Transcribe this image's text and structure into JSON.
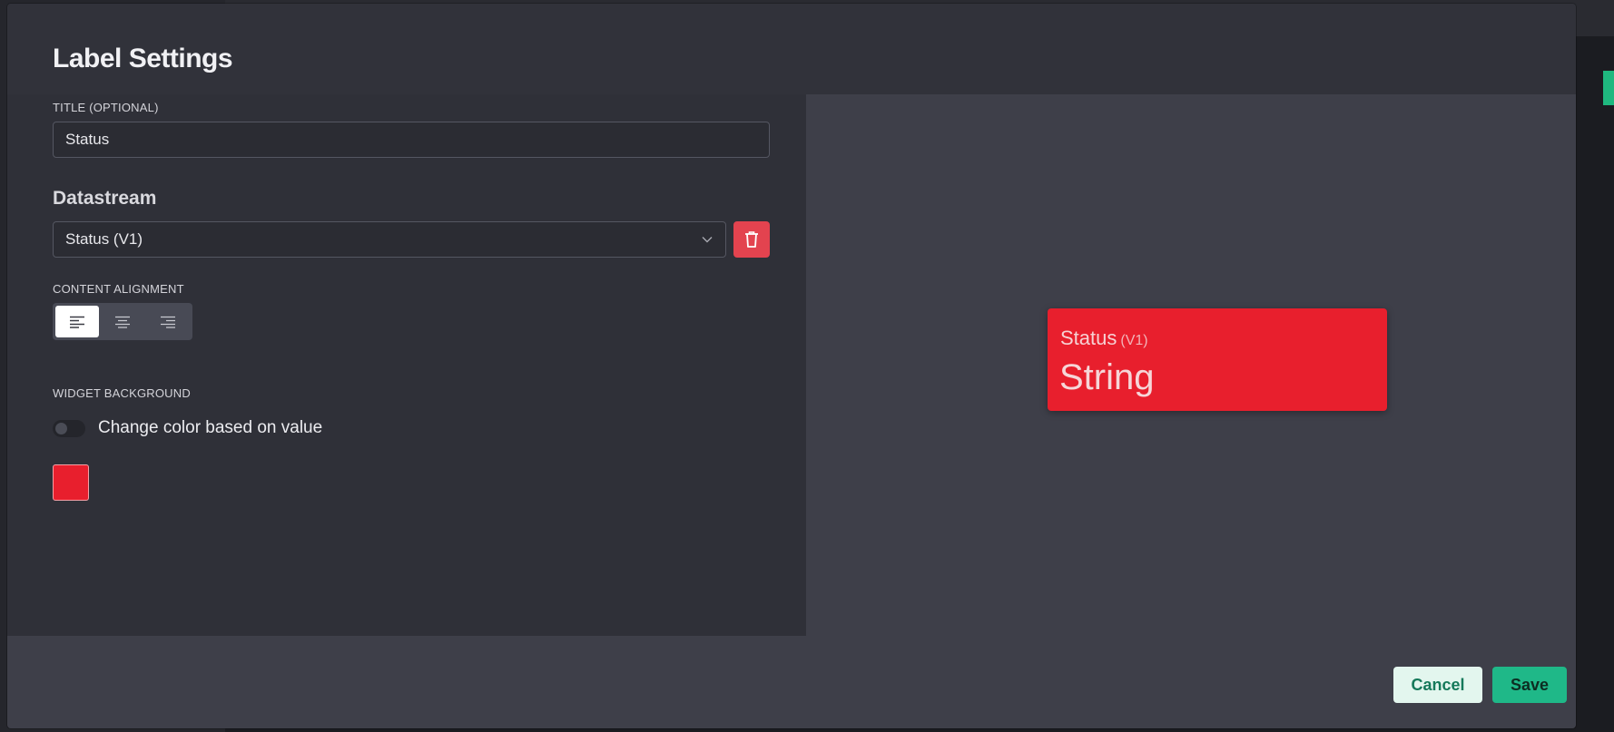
{
  "modal": {
    "title": "Label Settings"
  },
  "title_field": {
    "label": "TITLE (OPTIONAL)",
    "value": "Status"
  },
  "datastream": {
    "heading": "Datastream",
    "selected": "Status (V1)",
    "chevron_icon": "chevron-down-icon",
    "delete_icon": "trash-icon"
  },
  "alignment": {
    "label": "CONTENT ALIGNMENT",
    "options": [
      {
        "icon": "align-left-icon",
        "active": true
      },
      {
        "icon": "align-center-icon",
        "active": false
      },
      {
        "icon": "align-right-icon",
        "active": false
      }
    ]
  },
  "widget_background": {
    "label": "WIDGET BACKGROUND",
    "toggle_label": "Change color based on value",
    "toggle_on": false,
    "color": "#e81f2d"
  },
  "preview": {
    "title": "Status",
    "pin": "(V1)",
    "value": "String",
    "background": "#e81f2d"
  },
  "footer": {
    "cancel_label": "Cancel",
    "save_label": "Save"
  },
  "colors": {
    "accent_green": "#1fb888",
    "danger_red": "#e3434f"
  }
}
